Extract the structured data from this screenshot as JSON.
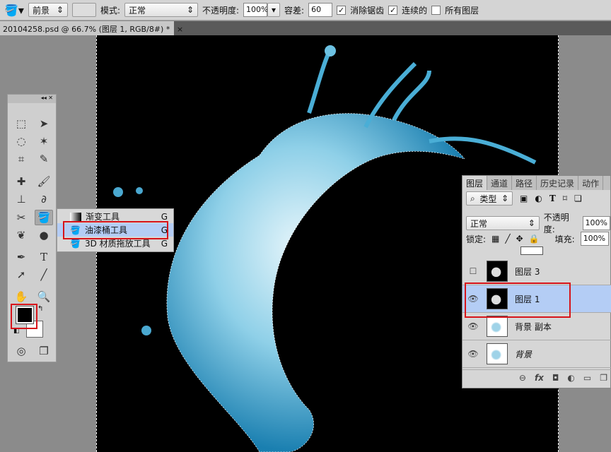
{
  "options_bar": {
    "tool_icon": "paint-bucket-icon",
    "fill_source": "前景",
    "mode_label": "模式:",
    "mode_value": "正常",
    "opacity_label": "不透明度:",
    "opacity_value": "100%",
    "tolerance_label": "容差:",
    "tolerance_value": "60",
    "anti_alias_label": "消除锯齿",
    "anti_alias_checked": true,
    "contiguous_label": "连续的",
    "contiguous_checked": true,
    "all_layers_label": "所有图层",
    "all_layers_checked": false
  },
  "document_tab": {
    "title": "20104258.psd @ 66.7% (图层 1, RGB/8#) *",
    "close": "×"
  },
  "toolbox": {
    "header_icons": "◂◂ ✕",
    "foreground_color": "#000000",
    "background_color": "#ffffff"
  },
  "flyout": {
    "items": [
      {
        "label": "渐变工具",
        "key": "G"
      },
      {
        "label": "油漆桶工具",
        "key": "G",
        "selected": true
      },
      {
        "label": "3D 材质拖放工具",
        "key": "G"
      }
    ]
  },
  "layers_panel": {
    "tabs": [
      "图层",
      "通道",
      "路径",
      "历史记录",
      "动作"
    ],
    "filter_label": "类型",
    "blend_mode": "正常",
    "opacity_label": "不透明度:",
    "opacity_value": "100%",
    "lock_label": "锁定:",
    "fill_label": "填充:",
    "fill_value": "100%",
    "layers": [
      {
        "name": "图层 3",
        "visible": false
      },
      {
        "name": "图层 1",
        "visible": true,
        "selected": true
      },
      {
        "name": "背景 副本",
        "visible": true
      },
      {
        "name": "背景",
        "visible": true
      }
    ],
    "bottom_icons": [
      "link-icon",
      "fx-icon",
      "mask-icon",
      "adjustment-icon",
      "folder-icon",
      "new-layer-icon"
    ]
  },
  "colors": {
    "highlight": "#b4cdf5",
    "annotation": "#d7141a"
  }
}
